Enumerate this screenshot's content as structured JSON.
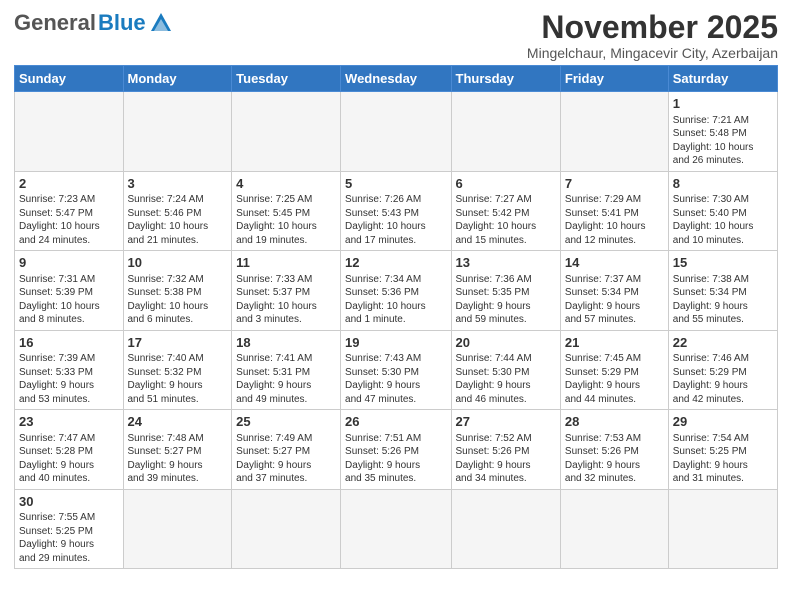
{
  "header": {
    "logo_general": "General",
    "logo_blue": "Blue",
    "month_title": "November 2025",
    "location": "Mingelchaur, Mingacevir City, Azerbaijan"
  },
  "weekdays": [
    "Sunday",
    "Monday",
    "Tuesday",
    "Wednesday",
    "Thursday",
    "Friday",
    "Saturday"
  ],
  "weeks": [
    [
      {
        "day": "",
        "info": ""
      },
      {
        "day": "",
        "info": ""
      },
      {
        "day": "",
        "info": ""
      },
      {
        "day": "",
        "info": ""
      },
      {
        "day": "",
        "info": ""
      },
      {
        "day": "",
        "info": ""
      },
      {
        "day": "1",
        "info": "Sunrise: 7:21 AM\nSunset: 5:48 PM\nDaylight: 10 hours\nand 26 minutes."
      }
    ],
    [
      {
        "day": "2",
        "info": "Sunrise: 7:23 AM\nSunset: 5:47 PM\nDaylight: 10 hours\nand 24 minutes."
      },
      {
        "day": "3",
        "info": "Sunrise: 7:24 AM\nSunset: 5:46 PM\nDaylight: 10 hours\nand 21 minutes."
      },
      {
        "day": "4",
        "info": "Sunrise: 7:25 AM\nSunset: 5:45 PM\nDaylight: 10 hours\nand 19 minutes."
      },
      {
        "day": "5",
        "info": "Sunrise: 7:26 AM\nSunset: 5:43 PM\nDaylight: 10 hours\nand 17 minutes."
      },
      {
        "day": "6",
        "info": "Sunrise: 7:27 AM\nSunset: 5:42 PM\nDaylight: 10 hours\nand 15 minutes."
      },
      {
        "day": "7",
        "info": "Sunrise: 7:29 AM\nSunset: 5:41 PM\nDaylight: 10 hours\nand 12 minutes."
      },
      {
        "day": "8",
        "info": "Sunrise: 7:30 AM\nSunset: 5:40 PM\nDaylight: 10 hours\nand 10 minutes."
      }
    ],
    [
      {
        "day": "9",
        "info": "Sunrise: 7:31 AM\nSunset: 5:39 PM\nDaylight: 10 hours\nand 8 minutes."
      },
      {
        "day": "10",
        "info": "Sunrise: 7:32 AM\nSunset: 5:38 PM\nDaylight: 10 hours\nand 6 minutes."
      },
      {
        "day": "11",
        "info": "Sunrise: 7:33 AM\nSunset: 5:37 PM\nDaylight: 10 hours\nand 3 minutes."
      },
      {
        "day": "12",
        "info": "Sunrise: 7:34 AM\nSunset: 5:36 PM\nDaylight: 10 hours\nand 1 minute."
      },
      {
        "day": "13",
        "info": "Sunrise: 7:36 AM\nSunset: 5:35 PM\nDaylight: 9 hours\nand 59 minutes."
      },
      {
        "day": "14",
        "info": "Sunrise: 7:37 AM\nSunset: 5:34 PM\nDaylight: 9 hours\nand 57 minutes."
      },
      {
        "day": "15",
        "info": "Sunrise: 7:38 AM\nSunset: 5:34 PM\nDaylight: 9 hours\nand 55 minutes."
      }
    ],
    [
      {
        "day": "16",
        "info": "Sunrise: 7:39 AM\nSunset: 5:33 PM\nDaylight: 9 hours\nand 53 minutes."
      },
      {
        "day": "17",
        "info": "Sunrise: 7:40 AM\nSunset: 5:32 PM\nDaylight: 9 hours\nand 51 minutes."
      },
      {
        "day": "18",
        "info": "Sunrise: 7:41 AM\nSunset: 5:31 PM\nDaylight: 9 hours\nand 49 minutes."
      },
      {
        "day": "19",
        "info": "Sunrise: 7:43 AM\nSunset: 5:30 PM\nDaylight: 9 hours\nand 47 minutes."
      },
      {
        "day": "20",
        "info": "Sunrise: 7:44 AM\nSunset: 5:30 PM\nDaylight: 9 hours\nand 46 minutes."
      },
      {
        "day": "21",
        "info": "Sunrise: 7:45 AM\nSunset: 5:29 PM\nDaylight: 9 hours\nand 44 minutes."
      },
      {
        "day": "22",
        "info": "Sunrise: 7:46 AM\nSunset: 5:29 PM\nDaylight: 9 hours\nand 42 minutes."
      }
    ],
    [
      {
        "day": "23",
        "info": "Sunrise: 7:47 AM\nSunset: 5:28 PM\nDaylight: 9 hours\nand 40 minutes."
      },
      {
        "day": "24",
        "info": "Sunrise: 7:48 AM\nSunset: 5:27 PM\nDaylight: 9 hours\nand 39 minutes."
      },
      {
        "day": "25",
        "info": "Sunrise: 7:49 AM\nSunset: 5:27 PM\nDaylight: 9 hours\nand 37 minutes."
      },
      {
        "day": "26",
        "info": "Sunrise: 7:51 AM\nSunset: 5:26 PM\nDaylight: 9 hours\nand 35 minutes."
      },
      {
        "day": "27",
        "info": "Sunrise: 7:52 AM\nSunset: 5:26 PM\nDaylight: 9 hours\nand 34 minutes."
      },
      {
        "day": "28",
        "info": "Sunrise: 7:53 AM\nSunset: 5:26 PM\nDaylight: 9 hours\nand 32 minutes."
      },
      {
        "day": "29",
        "info": "Sunrise: 7:54 AM\nSunset: 5:25 PM\nDaylight: 9 hours\nand 31 minutes."
      }
    ],
    [
      {
        "day": "30",
        "info": "Sunrise: 7:55 AM\nSunset: 5:25 PM\nDaylight: 9 hours\nand 29 minutes."
      },
      {
        "day": "",
        "info": ""
      },
      {
        "day": "",
        "info": ""
      },
      {
        "day": "",
        "info": ""
      },
      {
        "day": "",
        "info": ""
      },
      {
        "day": "",
        "info": ""
      },
      {
        "day": "",
        "info": ""
      }
    ]
  ]
}
